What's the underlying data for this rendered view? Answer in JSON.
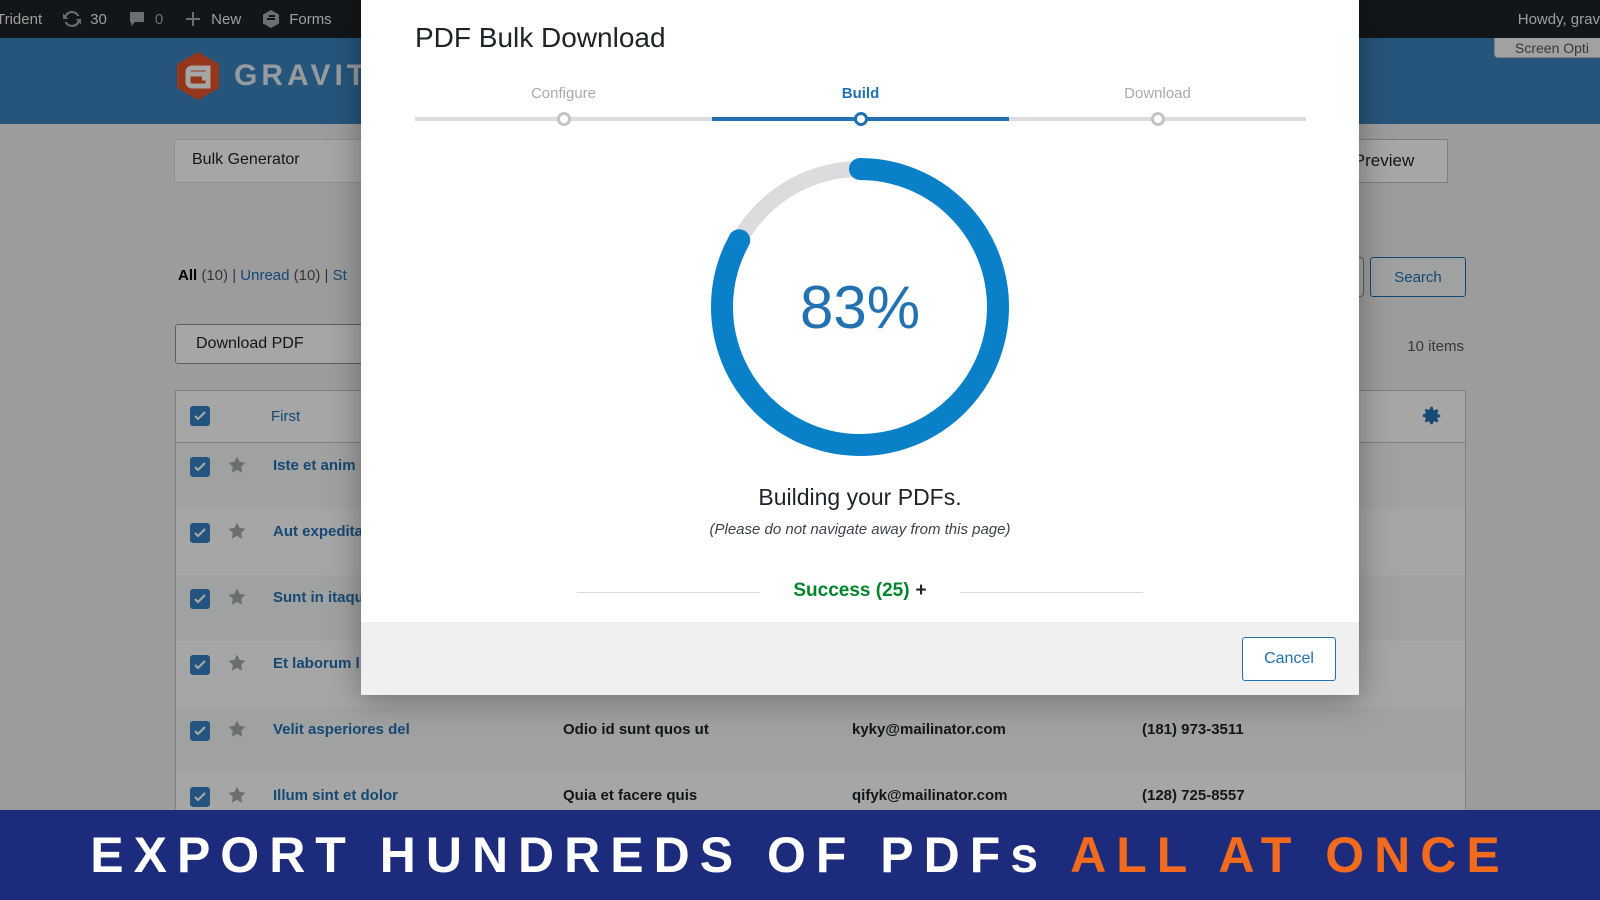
{
  "adminbar": {
    "site": "Trident",
    "updates": "30",
    "comments": "0",
    "new": "New",
    "forms": "Forms",
    "greeting": "Howdy, grav"
  },
  "header": {
    "logo_text": "GRAVITY",
    "screen_options": "Screen Opti"
  },
  "page": {
    "bulk_generator": "Bulk Generator",
    "preview": "Preview",
    "filters": {
      "all": "All",
      "all_count": "(10)",
      "sep1": "|",
      "unread": "Unread",
      "unread_count": "(10)",
      "sep2": "|",
      "starred_partial": "St"
    },
    "search_button": "Search",
    "bulk_action": "Download PDF",
    "items_count": "10 items",
    "table": {
      "col_first": "First",
      "rows": [
        {
          "c1": "Iste et anim",
          "c2": "",
          "c3": "",
          "c4": ""
        },
        {
          "c1": "Aut expedita",
          "c2": "",
          "c3": "",
          "c4": ""
        },
        {
          "c1": "Sunt in itaqu",
          "c2": "",
          "c3": "",
          "c4": ""
        },
        {
          "c1": "Et laborum l",
          "c2": "",
          "c3": "",
          "c4": ""
        },
        {
          "c1": "Velit asperiores del",
          "c2": "Odio id sunt quos ut",
          "c3": "kyky@mailinator.com",
          "c4": "(181) 973-3511"
        },
        {
          "c1": "Illum sint et dolor",
          "c2": "Quia et facere quis",
          "c3": "qifyk@mailinator.com",
          "c4": "(128) 725-8557"
        }
      ]
    }
  },
  "modal": {
    "title": "PDF Bulk Download",
    "steps": [
      {
        "label": "Configure",
        "active": false
      },
      {
        "label": "Build",
        "active": true
      },
      {
        "label": "Download",
        "active": false
      }
    ],
    "progress_percent": 83,
    "progress_label": "83%",
    "building_text": "Building your PDFs.",
    "warning_text": "(Please do not navigate away from this page)",
    "success_text": "Success (25)",
    "success_toggle": "+",
    "cancel": "Cancel"
  },
  "banner": {
    "text_main": "EXPORT HUNDREDS OF PDFs",
    "text_highlight": "ALL AT ONCE"
  },
  "colors": {
    "accent": "#2271b1",
    "success": "#00852b",
    "banner_bg": "#1d2b7d",
    "banner_highlight": "#f26b1d",
    "header_bg": "#3a83bd"
  }
}
